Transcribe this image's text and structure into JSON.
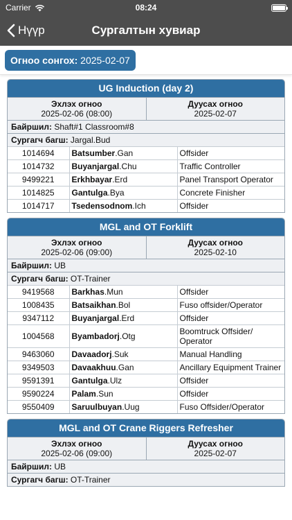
{
  "status": {
    "carrier": "Carrier",
    "time": "08:24"
  },
  "nav": {
    "back_label": "Нүүр",
    "title": "Сургалтын хувиар"
  },
  "date_picker": {
    "label": "Огноо сонгох:",
    "value": "2025-02-07"
  },
  "labels": {
    "start": "Эхлэх огноо",
    "end": "Дуусах огноо",
    "location": "Байршил:",
    "trainer": "Сургагч багш:"
  },
  "courses": [
    {
      "title": "UG Induction (day 2)",
      "start": "2025-02-06 (08:00)",
      "end": "2025-02-07",
      "location": "Shaft#1 Classroom#8",
      "trainer": "Jargal.Bud",
      "participants": [
        {
          "id": "1014694",
          "first": "Batsumber",
          "last": ".Gan",
          "position": "Offsider"
        },
        {
          "id": "1014732",
          "first": "Buyanjargal",
          "last": ".Chu",
          "position": "Traffic Controller"
        },
        {
          "id": "9499221",
          "first": "Erkhbayar",
          "last": ".Erd",
          "position": "Panel Transport Operator"
        },
        {
          "id": "1014825",
          "first": "Gantulga",
          "last": ".Bya",
          "position": "Concrete Finisher"
        },
        {
          "id": "1014717",
          "first": "Tsedensodnom",
          "last": ".Ich",
          "position": "Offsider"
        }
      ]
    },
    {
      "title": "MGL and OT Forklift",
      "start": "2025-02-06 (09:00)",
      "end": "2025-02-10",
      "location": "UB",
      "trainer": "OT-Trainer",
      "participants": [
        {
          "id": "9419568",
          "first": "Barkhas",
          "last": ".Mun",
          "position": "Offsider"
        },
        {
          "id": "1008435",
          "first": "Batsaikhan",
          "last": ".Bol",
          "position": "Fuso offsider/Operator"
        },
        {
          "id": "9347112",
          "first": "Buyanjargal",
          "last": ".Erd",
          "position": "Offsider"
        },
        {
          "id": "1004568",
          "first": "Byambadorj",
          "last": ".Otg",
          "position": "Boomtruck Offsider/ Operator"
        },
        {
          "id": "9463060",
          "first": "Davaadorj",
          "last": ".Suk",
          "position": "Manual Handling"
        },
        {
          "id": "9349503",
          "first": "Davaakhuu",
          "last": ".Gan",
          "position": "Ancillary Equipment Trainer"
        },
        {
          "id": "9591391",
          "first": "Gantulga",
          "last": ".Ulz",
          "position": "Offsider"
        },
        {
          "id": "9590224",
          "first": "Palam",
          "last": ".Sun",
          "position": "Offsider"
        },
        {
          "id": "9550409",
          "first": "Saruulbuyan",
          "last": ".Uug",
          "position": "Fuso Offsider/Operator"
        }
      ]
    },
    {
      "title": "MGL and OT Crane Riggers Refresher",
      "start": "2025-02-06 (09:00)",
      "end": "2025-02-07",
      "location": "UB",
      "trainer": "OT-Trainer",
      "participants": []
    }
  ]
}
